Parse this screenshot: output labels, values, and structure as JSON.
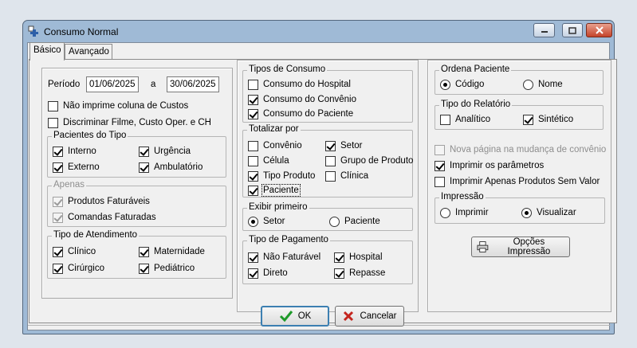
{
  "window": {
    "title": "Consumo Normal"
  },
  "tabs": [
    {
      "label": "Básico",
      "active": true
    },
    {
      "label": "Avançado",
      "active": false
    }
  ],
  "periodo": {
    "label": "Período",
    "start": "01/06/2025",
    "between": "a",
    "end": "30/06/2025"
  },
  "options_top": [
    {
      "label": "Não imprime coluna de Custos",
      "checked": false
    },
    {
      "label": "Discriminar Filme, Custo Oper. e CH",
      "checked": false
    }
  ],
  "pacientes_tipo": {
    "title": "Pacientes do Tipo",
    "items": [
      {
        "label": "Interno",
        "checked": true
      },
      {
        "label": "Urgência",
        "checked": true
      },
      {
        "label": "Externo",
        "checked": true
      },
      {
        "label": "Ambulatório",
        "checked": true
      }
    ]
  },
  "apenas": {
    "title": "Apenas",
    "items": [
      {
        "label": "Produtos Faturáveis",
        "checked": true,
        "disabled": true
      },
      {
        "label": "Comandas Faturadas",
        "checked": true,
        "disabled": true
      }
    ]
  },
  "tipo_atendimento": {
    "title": "Tipo de Atendimento",
    "items": [
      {
        "label": "Clínico",
        "checked": true
      },
      {
        "label": "Maternidade",
        "checked": true
      },
      {
        "label": "Cirúrgico",
        "checked": true
      },
      {
        "label": "Pediátrico",
        "checked": true
      }
    ]
  },
  "tipos_consumo": {
    "title": "Tipos de Consumo",
    "items": [
      {
        "label": "Consumo do Hospital",
        "checked": false
      },
      {
        "label": "Consumo do Convênio",
        "checked": true
      },
      {
        "label": "Consumo do Paciente",
        "checked": true
      }
    ]
  },
  "totalizar": {
    "title": "Totalizar por",
    "items": [
      {
        "label": "Convênio",
        "checked": false
      },
      {
        "label": "Setor",
        "checked": true
      },
      {
        "label": "Célula",
        "checked": false
      },
      {
        "label": "Grupo de Produto",
        "checked": false
      },
      {
        "label": "Tipo Produto",
        "checked": true
      },
      {
        "label": "Clínica",
        "checked": false
      },
      {
        "label": "Paciente",
        "checked": true
      }
    ]
  },
  "exibir_primeiro": {
    "title": "Exibir primeiro",
    "options": [
      {
        "label": "Setor",
        "selected": true
      },
      {
        "label": "Paciente",
        "selected": false
      }
    ]
  },
  "tipo_pagamento": {
    "title": "Tipo de Pagamento",
    "items": [
      {
        "label": "Não Faturável",
        "checked": true
      },
      {
        "label": "Hospital",
        "checked": true
      },
      {
        "label": "Direto",
        "checked": true
      },
      {
        "label": "Repasse",
        "checked": true
      }
    ]
  },
  "ordena_paciente": {
    "title": "Ordena Paciente",
    "options": [
      {
        "label": "Código",
        "selected": true
      },
      {
        "label": "Nome",
        "selected": false
      }
    ]
  },
  "tipo_relatorio": {
    "title": "Tipo do Relatório",
    "items": [
      {
        "label": "Analítico",
        "checked": false
      },
      {
        "label": "Sintético",
        "checked": true
      }
    ]
  },
  "options_right": [
    {
      "label": "Nova página na mudança de convênio",
      "checked": false,
      "disabled": true
    },
    {
      "label": "Imprimir os parâmetros",
      "checked": true
    },
    {
      "label": "Imprimir Apenas Produtos Sem Valor",
      "checked": false
    }
  ],
  "impressao": {
    "title": "Impressão",
    "options": [
      {
        "label": "Imprimir",
        "selected": false
      },
      {
        "label": "Visualizar",
        "selected": true
      }
    ]
  },
  "buttons": {
    "opcoes": "Opções Impressão",
    "ok": "OK",
    "cancel": "Cancelar"
  },
  "colors": {
    "title_bar": "#9fbad6",
    "face": "#f0f0f0",
    "ok_icon": "#1f9a2a",
    "cancel_icon": "#c4251e"
  }
}
